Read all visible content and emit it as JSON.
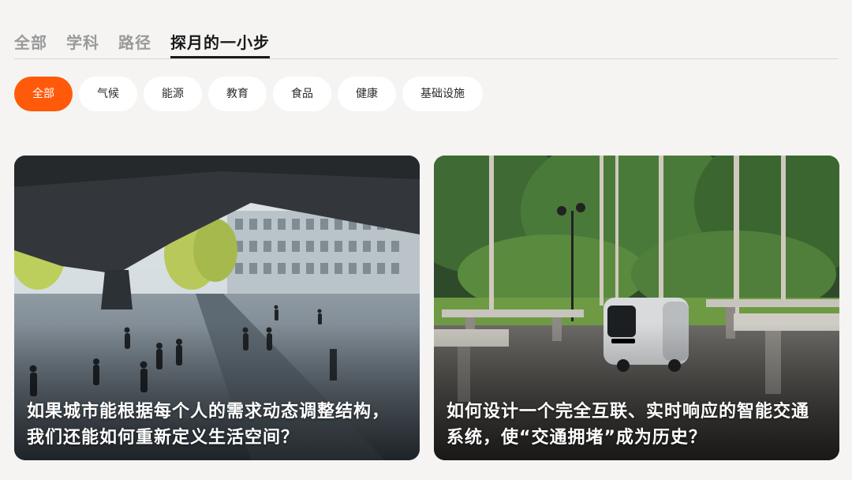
{
  "tabs": [
    {
      "label": "全部"
    },
    {
      "label": "学科"
    },
    {
      "label": "路径"
    },
    {
      "label": "探月的一小步"
    }
  ],
  "active_tab_index": 3,
  "filters": [
    {
      "label": "全部"
    },
    {
      "label": "气候"
    },
    {
      "label": "能源"
    },
    {
      "label": "教育"
    },
    {
      "label": "食品"
    },
    {
      "label": "健康"
    },
    {
      "label": "基础设施"
    }
  ],
  "active_filter_index": 0,
  "colors": {
    "accent": "#ff5a0a",
    "background": "#f5f4f3"
  },
  "cards": [
    {
      "title": "如果城市能根据每个人的需求动态调整结构，我们还能如何重新定义生活空间？"
    },
    {
      "title": "如何设计一个完全互联、实时响应的智能交通系统，使“交通拥堵”成为历史？"
    }
  ]
}
